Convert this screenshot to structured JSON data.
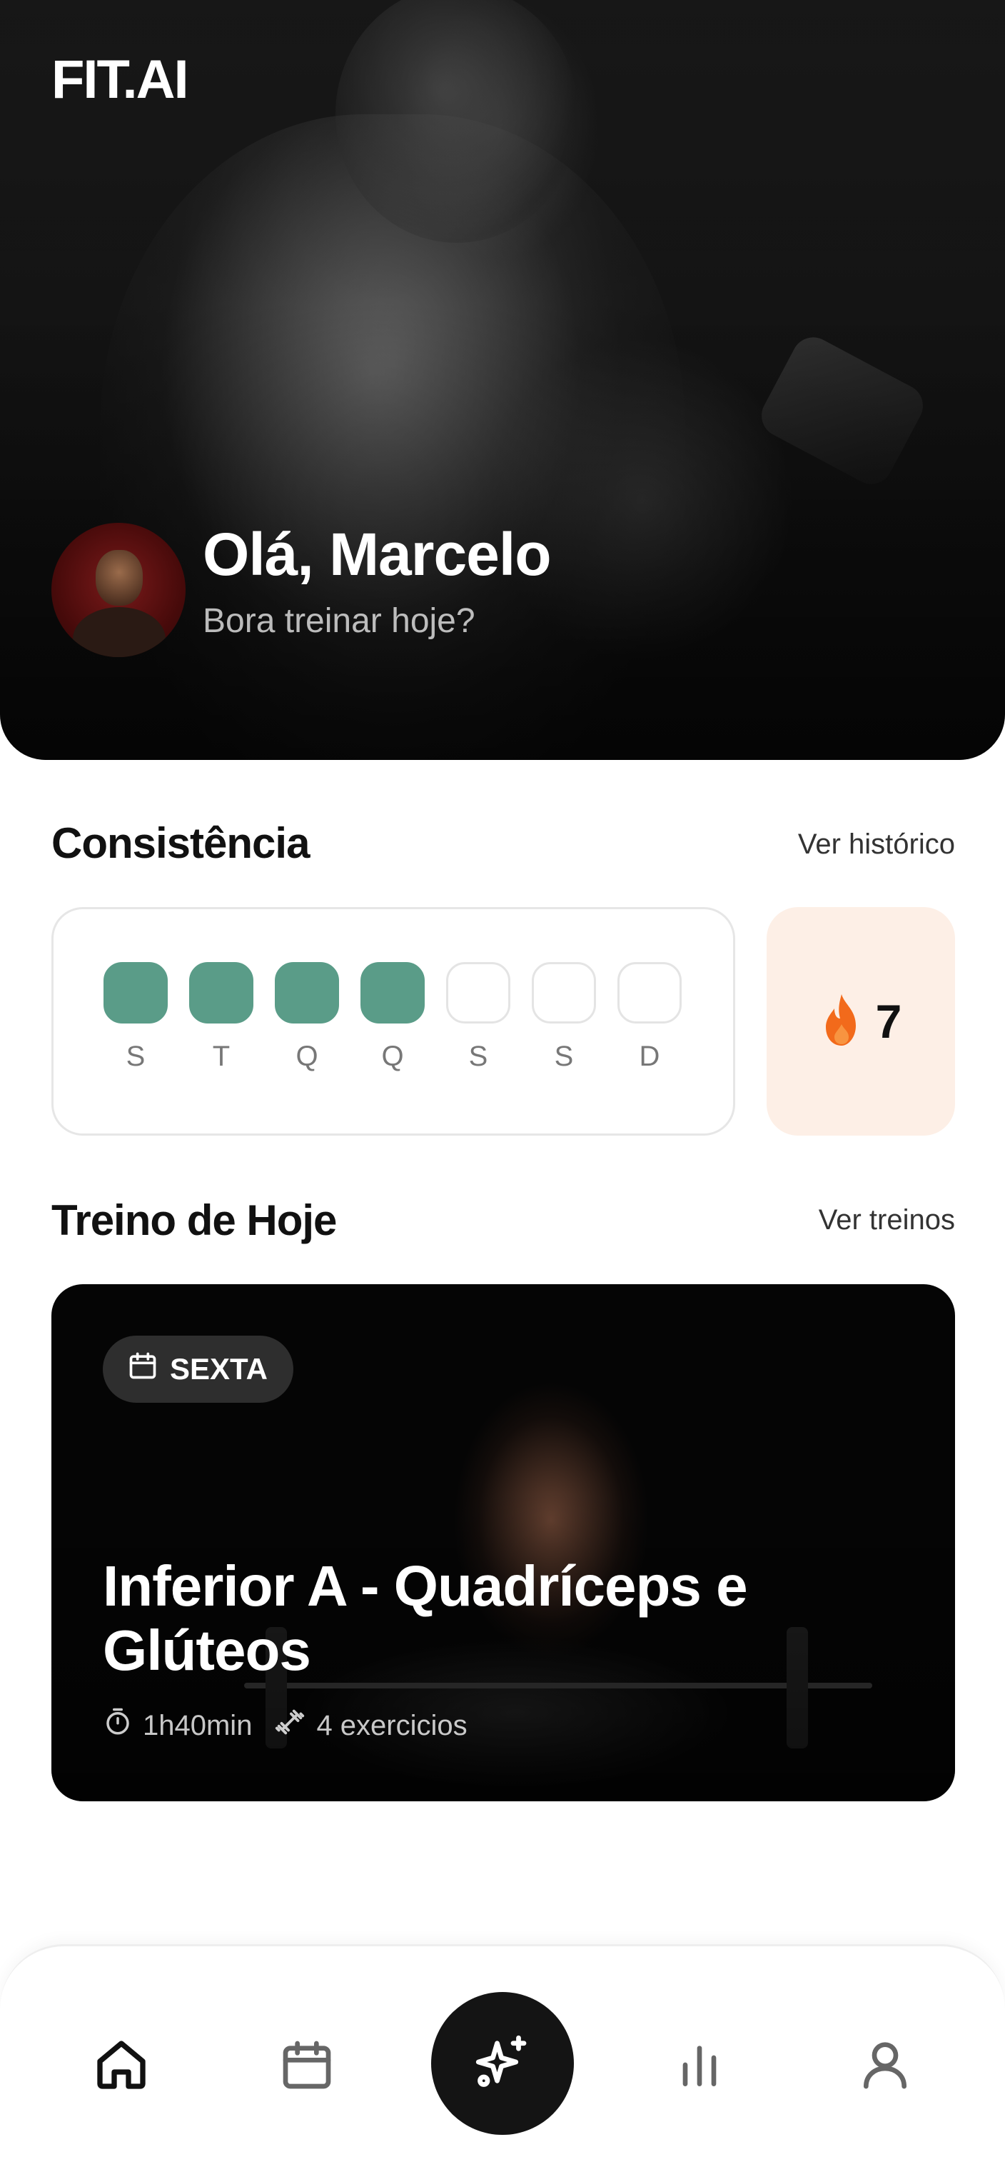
{
  "header": {
    "logo": "FIT.AI",
    "greeting": "Olá, Marcelo",
    "subtitle": "Bora treinar hoje?"
  },
  "consistency": {
    "title": "Consistência",
    "link": "Ver histórico",
    "days": [
      {
        "letter": "S",
        "done": true
      },
      {
        "letter": "T",
        "done": true
      },
      {
        "letter": "Q",
        "done": true
      },
      {
        "letter": "Q",
        "done": true
      },
      {
        "letter": "S",
        "done": false
      },
      {
        "letter": "S",
        "done": false
      },
      {
        "letter": "D",
        "done": false
      }
    ],
    "streak": "7",
    "done_color": "#5a9c88",
    "streak_bg": "#fdefe6",
    "flame_color": "#f26a1b"
  },
  "today": {
    "title": "Treino de Hoje",
    "link": "Ver treinos",
    "day_badge": "SEXTA",
    "workout_title": "Inferior A - Quadríceps e Glúteos",
    "duration": "1h40min",
    "exercises": "4 exercicios"
  },
  "nav": {
    "items": [
      "home-icon",
      "calendar-icon",
      "sparkles-icon",
      "chart-icon",
      "user-icon"
    ]
  }
}
